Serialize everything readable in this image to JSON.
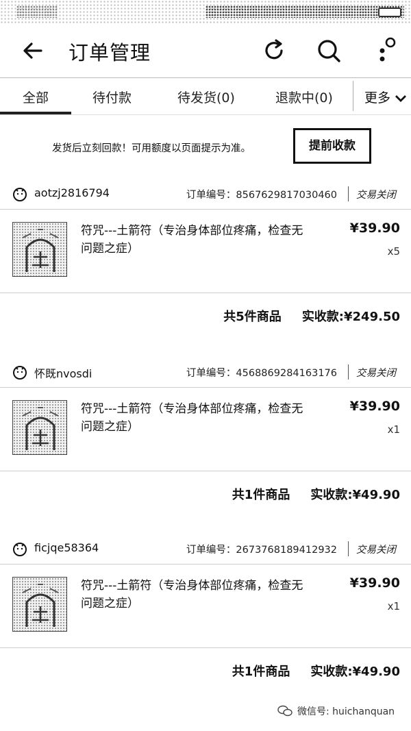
{
  "appbar": {
    "title": "订单管理",
    "back_icon": "back-arrow-icon",
    "refresh_icon": "refresh-icon",
    "search_icon": "search-icon",
    "menu_icon": "more-dots-icon"
  },
  "tabs": [
    {
      "label": "全部",
      "active": true
    },
    {
      "label": "待付款"
    },
    {
      "label": "待发货(0)"
    },
    {
      "label": "退款中(0)"
    }
  ],
  "more_tab": {
    "label": "更多",
    "icon": "chevron-down-icon"
  },
  "notice": {
    "text": "发货后立刻回款！可用额度以页面提示为准。",
    "button": "提前收款"
  },
  "orders": [
    {
      "user": "aotzj2816794",
      "order_no": "订单编号：8567629817030460",
      "status": "交易关闭",
      "product_name": "符咒---土箭符（专治身体部位疼痛，检查无问题之症）",
      "price": "¥39.90",
      "qty": "x5",
      "count_text": "共5件商品",
      "paid": "实收款:¥249.50"
    },
    {
      "user": "怀既nvosdi",
      "order_no": "订单编号：4568869284163176",
      "status": "交易关闭",
      "product_name": "符咒---土箭符（专治身体部位疼痛，检查无问题之症）",
      "price": "¥39.90",
      "qty": "x1",
      "count_text": "共1件商品",
      "paid": "实收款:¥49.90"
    },
    {
      "user": "ficjqe58364",
      "order_no": "订单编号：2673768189412932",
      "status": "交易关闭",
      "product_name": "符咒---土箭符（专治身体部位疼痛，检查无问题之症）",
      "price": "¥39.90",
      "qty": "x1",
      "count_text": "共1件商品",
      "paid": "实收款:¥49.90"
    }
  ],
  "watermark": "微信号: huichanquan"
}
